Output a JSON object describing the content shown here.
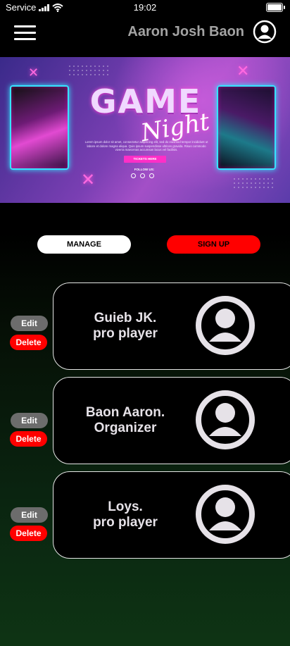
{
  "status_bar": {
    "carrier": "Service",
    "time": "19:02",
    "battery_level": 0.9
  },
  "header": {
    "user_name": "Aaron Josh Baon",
    "menu_icon": "hamburger-menu-icon",
    "avatar_icon": "user-circle-icon"
  },
  "banner": {
    "title": "GAME",
    "subtitle": "Night",
    "body": "Lorem ipsum dolor sit amet, consectetur adipiscing elit, sed do eiusmod tempor incididunt ut labore et dolore magna aliqua. Quis ipsum suspendisse ultrices gravida. Risus commodo viverra maecenas accumsan lacus vel facilisis.",
    "tickets_label": "TICKETS HERE",
    "follow_label": "FOLLOW US:"
  },
  "actions": {
    "manage_label": "MANAGE",
    "signup_label": "SIGN UP"
  },
  "members": [
    {
      "name": "Guieb JK.\npro player"
    },
    {
      "name": "Baon Aaron.\nOrganizer"
    },
    {
      "name": "Loys.\npro player"
    }
  ],
  "row_actions": {
    "edit_label": "Edit",
    "delete_label": "Delete"
  },
  "colors": {
    "signup": "#ff0000",
    "delete": "#ff0000",
    "edit": "#6c6c6c",
    "avatar_fill": "#e6e2e8"
  }
}
